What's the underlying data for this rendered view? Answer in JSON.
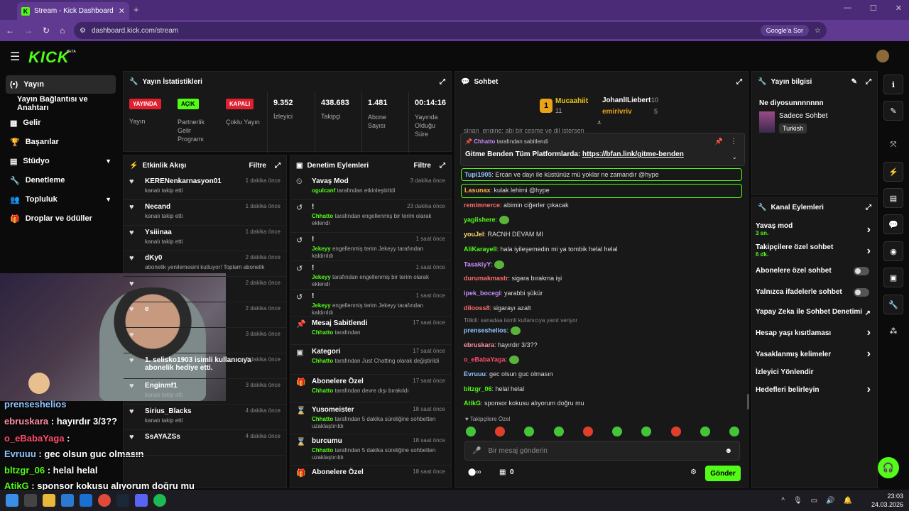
{
  "browser": {
    "tab_title": "Stream - Kick Dashboard",
    "url": "dashboard.kick.com/stream",
    "google_btn": "Google'a Sor"
  },
  "brand": {
    "logo": "KICK",
    "beta": "BETA",
    "accent": "#53fc18"
  },
  "sidebar": {
    "items": [
      {
        "label": "Yayın",
        "icon": "broadcast-icon"
      },
      {
        "label": "Yayın Bağlantısı ve Anahtarı",
        "icon": ""
      },
      {
        "label": "Gelir",
        "icon": "revenue-icon"
      },
      {
        "label": "Başarılar",
        "icon": "trophy-icon"
      },
      {
        "label": "Stüdyo",
        "icon": "studio-icon"
      },
      {
        "label": "Denetleme",
        "icon": "wrench-icon"
      },
      {
        "label": "Topluluk",
        "icon": "community-icon"
      },
      {
        "label": "Droplar ve ödüller",
        "icon": "gift-icon"
      }
    ]
  },
  "stats": {
    "title": "Yayın İstatistikleri",
    "badges": [
      {
        "badge": "YAYINDA",
        "label": "Yayın"
      },
      {
        "badge": "AÇIK",
        "label": "Partnerlik Gelir Programı"
      },
      {
        "badge": "KAPALI",
        "label": "Çoklu Yayın"
      }
    ],
    "values": [
      {
        "v": "9.352",
        "label": "İzleyici"
      },
      {
        "v": "438.683",
        "label": "Takipçi"
      },
      {
        "v": "1.481",
        "label": "Abone Sayısı"
      },
      {
        "v": "00:14:16",
        "label": "Yayında Olduğu Süre"
      }
    ]
  },
  "activity": {
    "title": "Etkinlik Akışı",
    "filter": "Filtre",
    "items": [
      {
        "name": "KERENenkarnasyon01",
        "sub": "kanalı takip etti",
        "time": "1 dakika önce"
      },
      {
        "name": "Necand",
        "sub": "kanalı takip etti",
        "time": "1 dakika önce"
      },
      {
        "name": "Ysiiinaa",
        "sub": "kanalı takip etti",
        "time": "1 dakika önce"
      },
      {
        "name": "dKy0",
        "sub": "abonelik yenilemesini kutluyor! Toplam abonelik",
        "time": "2 dakika önce"
      },
      {
        "name": "",
        "sub": "",
        "time": "2 dakika önce"
      },
      {
        "name": "e",
        "sub": "",
        "time": "2 dakika önce"
      },
      {
        "name": "",
        "sub": "",
        "time": "3 dakika önce"
      },
      {
        "name": "1. selisko1903 isimli kullanıcıya abonelik hediye etti.",
        "sub": "",
        "time": "3 dakika önce"
      },
      {
        "name": "Enginmf1",
        "sub": "kanalı takip etti",
        "time": "3 dakika önce"
      },
      {
        "name": "Sirius_Blacks",
        "sub": "kanalı takip etti",
        "time": "4 dakika önce"
      },
      {
        "name": "SsAYAZSs",
        "sub": "",
        "time": "4 dakika önce"
      }
    ]
  },
  "moderation": {
    "title": "Denetim Eylemleri",
    "filter": "Filtre",
    "items": [
      {
        "title": "Yavaş Mod",
        "sub_user": "ogulcanf",
        "sub": "tarafından etkinleştirildi",
        "time": "3 dakika önce"
      },
      {
        "title": "!",
        "sub_user": "Chhatto",
        "sub": "tarafından engellenmiş bir terim olarak eklendi",
        "time": "23 dakika önce"
      },
      {
        "title": "!",
        "sub_user": "Jekeyy",
        "sub": "engellenmiş terim Jekeyy tarafından kaldırıldı",
        "time": "1 saat önce"
      },
      {
        "title": "!",
        "sub_user": "Jekeyy",
        "sub": "tarafından engellenmiş bir terim olarak eklendi",
        "time": "1 saat önce"
      },
      {
        "title": "!",
        "sub_user": "Jekeyy",
        "sub": "engellenmiş terim Jekeyy tarafından kaldırıldı",
        "time": "1 saat önce"
      },
      {
        "title": "Mesaj Sabitlendi",
        "sub_user": "Chhatto",
        "sub": "tarafından",
        "time": "17 saat önce"
      },
      {
        "title": "Kategori",
        "sub_user": "Chhatto",
        "sub": "tarafından Just Chatting olarak değiştirildi",
        "time": "17 saat önce"
      },
      {
        "title": "Abonelere Özel",
        "sub_user": "Chhatto",
        "sub": "tarafından devre dışı bırakıldı",
        "time": "17 saat önce"
      },
      {
        "title": "Yusomeister",
        "sub_user": "Chhatto",
        "sub": "tarafından 5 dakika süreliğine sohbetten uzaklaştırıldı",
        "time": "18 saat önce"
      },
      {
        "title": "burcumu",
        "sub_user": "Chhatto",
        "sub": "tarafından 5 dakika süreliğine sohbetten uzaklaştırıldı",
        "time": "18 saat önce"
      },
      {
        "title": "Abonelere Özel",
        "sub_user": "",
        "sub": "",
        "time": "18 saat önce"
      }
    ]
  },
  "chat": {
    "title": "Sohbet",
    "leaders": [
      {
        "name": "Mucaahiit",
        "count": "11"
      },
      {
        "name": "JohanlILiebert",
        "count": "10"
      },
      {
        "name": "emirivriv",
        "count": "5"
      }
    ],
    "pinned": {
      "user": "Chhatto",
      "label": "tarafından sabitlendi",
      "text": "Gitme Benden Tüm Platformlarda: ",
      "link": "https://bfan.link/gitme-benden"
    },
    "top_cut": "sinan_engine: abi bir çeşme ve dil istersen",
    "messages": [
      {
        "user": "Tupi1905",
        "color": "#8ec5ff",
        "text": "Ercan ve dayı ile küstünüz mü yoklar ne zamandır @hype"
      },
      {
        "user": "Lasunax",
        "color": "#ffb347",
        "text": "kulak lehimi @hype"
      },
      {
        "user": "remimnerce",
        "color": "#ff6b6b",
        "text": "abimin ciğerler çıkacak"
      },
      {
        "user": "yagiishere",
        "color": "#53fc18",
        "text": ""
      },
      {
        "user": "youJel",
        "color": "#ffd76e",
        "text": "RACNH DEVAM MI"
      },
      {
        "user": "AliKarayell",
        "color": "#53fc18",
        "text": "hala iyileşemedin mi ya tombik helal helal"
      },
      {
        "user": "TasakiyY",
        "color": "#c78bff",
        "text": ""
      },
      {
        "user": "durumakmastr",
        "color": "#ff6b6b",
        "text": "sigara bırakma işi"
      },
      {
        "user": "ipek_bocegi",
        "color": "#c78bff",
        "text": "yarabbi şükür"
      },
      {
        "user": "dilooss8",
        "color": "#ff6b6b",
        "text": "sigarayı azalt"
      },
      {
        "user": "prenseshelios",
        "color": "#8ec5ff",
        "text": ""
      },
      {
        "user": "ebruskara",
        "color": "#ff8fa3",
        "text": "hayırdır 3/3??"
      },
      {
        "user": "o_eBabaYaga",
        "color": "#ff4d6d",
        "text": ""
      },
      {
        "user": "Evruuu",
        "color": "#8ec5ff",
        "text": "gec olsun guc olmasın"
      },
      {
        "user": "bitzgr_06",
        "color": "#53fc18",
        "text": "helal helal"
      },
      {
        "user": "AtikG",
        "color": "#53fc18",
        "text": "sponsor kokusu alıyorum doğru mu"
      }
    ],
    "reply_note": "Tiilkili: sanadaa isimli kullanıcıya yanıt veriyor",
    "followers_only": "Takipçilere Özel",
    "placeholder": "Bir mesaj gönderin",
    "send": "Gönder",
    "points": "0"
  },
  "stream_info": {
    "title": "Yayın bilgisi",
    "stream_title": "Ne diyosunnnnnnn",
    "category": "Sadece Sohbet",
    "tag": "Turkish"
  },
  "channel_actions": {
    "title": "Kanal Eylemleri",
    "items": [
      {
        "label": "Yavaş mod",
        "sub": "3 sn.",
        "type": "chev"
      },
      {
        "label": "Takipçilere özel sohbet",
        "sub": "6 dk.",
        "type": "chev"
      },
      {
        "label": "Abonelere özel sohbet",
        "sub": "",
        "type": "toggle"
      },
      {
        "label": "Yalnızca ifadelerle sohbet",
        "sub": "",
        "type": "toggle"
      },
      {
        "label": "Yapay Zeka ile Sohbet Denetimi",
        "sub": "",
        "type": "ext"
      },
      {
        "label": "Hesap yaşı kısıtlaması",
        "sub": "",
        "type": "chev"
      },
      {
        "label": "Yasaklanmış kelimeler",
        "sub": "",
        "type": "chev"
      },
      {
        "label": "İzleyici Yönlendir",
        "sub": "",
        "type": "none"
      },
      {
        "label": "Hedefleri belirleyin",
        "sub": "",
        "type": "chev"
      }
    ]
  },
  "overlay": {
    "lines": [
      {
        "user": "prenseshelios",
        "text": "",
        "color": "#8ec5ff"
      },
      {
        "user": "ebruskara",
        "text": " : hayırdır 3/3??",
        "color": "#ff8fa3"
      },
      {
        "user": "o_eBabaYaga",
        "text": " :",
        "color": "#ff4d6d"
      },
      {
        "user": "Evruuu",
        "text": " : gec olsun guc olmasın",
        "color": "#8ec5ff"
      },
      {
        "user": "bltzgr_06",
        "text": " : helal helal",
        "color": "#53fc18"
      },
      {
        "user": "AtikG",
        "text": " : sponsor kokusu alıyorum doğru mu",
        "color": "#53fc18"
      }
    ]
  },
  "taskbar": {
    "time": "23:03",
    "date": "24.03.2026"
  }
}
